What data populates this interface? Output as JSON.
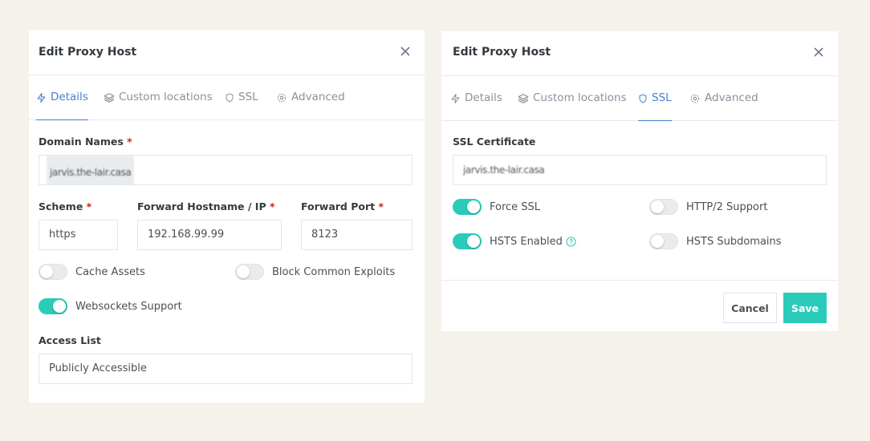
{
  "left_modal": {
    "title": "Edit Proxy Host",
    "tabs": [
      {
        "label": "Details",
        "icon": "lightning-icon",
        "active": true
      },
      {
        "label": "Custom locations",
        "icon": "layers-icon",
        "active": false
      },
      {
        "label": "SSL",
        "icon": "shield-icon",
        "active": false
      },
      {
        "label": "Advanced",
        "icon": "gear-icon",
        "active": false
      }
    ],
    "domain_names": {
      "label": "Domain Names",
      "required": "*",
      "value": "jarvis.the-lair.casa"
    },
    "scheme": {
      "label": "Scheme",
      "required": "*",
      "value": "https"
    },
    "forward_hostname": {
      "label": "Forward Hostname / IP",
      "required": "*",
      "value": "192.168.99.99"
    },
    "forward_port": {
      "label": "Forward Port",
      "required": "*",
      "value": "8123"
    },
    "toggles": {
      "cache_assets": {
        "label": "Cache Assets",
        "on": false
      },
      "block_exploits": {
        "label": "Block Common Exploits",
        "on": false
      },
      "websockets": {
        "label": "Websockets Support",
        "on": true
      }
    },
    "access_list": {
      "label": "Access List",
      "value": "Publicly Accessible"
    }
  },
  "right_modal": {
    "title": "Edit Proxy Host",
    "tabs": [
      {
        "label": "Details",
        "icon": "lightning-icon",
        "active": false
      },
      {
        "label": "Custom locations",
        "icon": "layers-icon",
        "active": false
      },
      {
        "label": "SSL",
        "icon": "shield-icon",
        "active": true
      },
      {
        "label": "Advanced",
        "icon": "gear-icon",
        "active": false
      }
    ],
    "ssl_certificate": {
      "label": "SSL Certificate",
      "value": "jarvis.the-lair.casa"
    },
    "toggles": {
      "force_ssl": {
        "label": "Force SSL",
        "on": true
      },
      "http2": {
        "label": "HTTP/2 Support",
        "on": false
      },
      "hsts": {
        "label": "HSTS Enabled",
        "on": true
      },
      "hsts_subdomains": {
        "label": "HSTS Subdomains",
        "on": false
      }
    },
    "footer": {
      "cancel_label": "Cancel",
      "save_label": "Save"
    }
  },
  "colors": {
    "accent": "#467fcf",
    "toggle_on": "#2bcbba",
    "required": "#cd201f",
    "background": "#f5f2ec"
  }
}
